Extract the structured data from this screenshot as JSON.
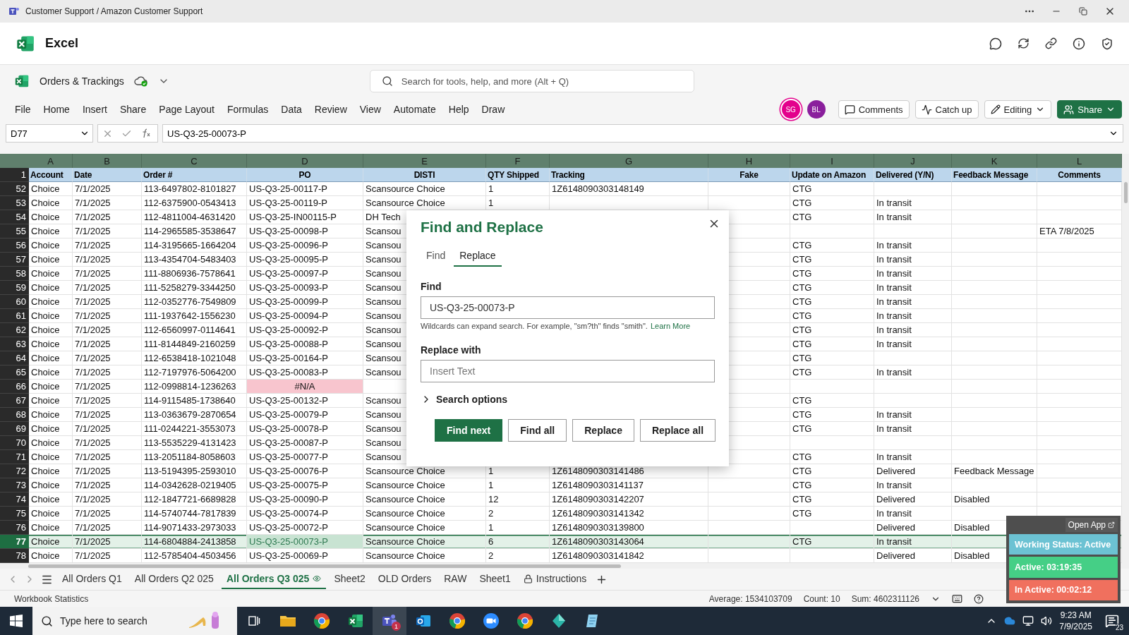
{
  "window": {
    "title": "Customer Support / Amazon Customer Support"
  },
  "app": {
    "name": "Excel"
  },
  "document": {
    "name": "Orders & Trackings"
  },
  "search": {
    "placeholder": "Search for tools, help, and more (Alt + Q)"
  },
  "menu": [
    "File",
    "Home",
    "Insert",
    "Share",
    "Page Layout",
    "Formulas",
    "Data",
    "Review",
    "View",
    "Automate",
    "Help",
    "Draw"
  ],
  "avatars": [
    {
      "initials": "SG",
      "color": "#e3008c",
      "selected": true
    },
    {
      "initials": "BL",
      "color": "#8a1f9c",
      "selected": false
    }
  ],
  "toolbar_buttons": [
    {
      "label": "Comments",
      "kind": "comments"
    },
    {
      "label": "Catch up",
      "kind": "catchup"
    },
    {
      "label": "Editing",
      "kind": "editing"
    },
    {
      "label": "Share",
      "kind": "share"
    }
  ],
  "formula_bar": {
    "cell_ref": "D77",
    "value": "US-Q3-25-00073-P"
  },
  "sheet": {
    "columns": [
      "A",
      "B",
      "C",
      "D",
      "E",
      "F",
      "G",
      "H",
      "I",
      "J",
      "K",
      "L"
    ],
    "header": {
      "number": "1",
      "cells": [
        "Account",
        "Date",
        "Order #",
        "PO",
        "DISTI",
        "QTY Shipped",
        "Tracking",
        "Fake",
        "Update on Amazon",
        "Delivered (Y/N)",
        "Feedback Message",
        "Comments"
      ]
    },
    "rows": [
      {
        "number": "52",
        "selected": false,
        "cells": [
          "Choice",
          "7/1/2025",
          "113-6497802-8101827",
          "US-Q3-25-00117-P",
          "Scansource Choice",
          "1",
          "1Z6148090303148149",
          null,
          "CTG",
          null,
          null,
          null
        ]
      },
      {
        "number": "53",
        "selected": false,
        "cells": [
          "Choice",
          "7/1/2025",
          "112-6375900-0543413",
          "US-Q3-25-00119-P",
          "Scansource Choice",
          "1",
          null,
          null,
          "CTG",
          "In transit",
          null,
          null
        ]
      },
      {
        "number": "54",
        "selected": false,
        "cells": [
          "Choice",
          "7/1/2025",
          "112-4811004-4631420",
          "US-Q3-25-IN00115-P",
          "DH Tech",
          null,
          null,
          null,
          "CTG",
          "In transit",
          null,
          null
        ]
      },
      {
        "number": "55",
        "selected": false,
        "cells": [
          "Choice",
          "7/1/2025",
          "114-2965585-3538647",
          "US-Q3-25-00098-P",
          "Scansou",
          null,
          null,
          null,
          null,
          null,
          null,
          "ETA 7/8/2025"
        ]
      },
      {
        "number": "56",
        "selected": false,
        "cells": [
          "Choice",
          "7/1/2025",
          "114-3195665-1664204",
          "US-Q3-25-00096-P",
          "Scansou",
          null,
          null,
          null,
          "CTG",
          "In transit",
          null,
          null
        ]
      },
      {
        "number": "57",
        "selected": false,
        "cells": [
          "Choice",
          "7/1/2025",
          "113-4354704-5483403",
          "US-Q3-25-00095-P",
          "Scansou",
          null,
          null,
          null,
          "CTG",
          "In transit",
          null,
          null
        ]
      },
      {
        "number": "58",
        "selected": false,
        "cells": [
          "Choice",
          "7/1/2025",
          "111-8806936-7578641",
          "US-Q3-25-00097-P",
          "Scansou",
          null,
          null,
          null,
          "CTG",
          "In transit",
          null,
          null
        ]
      },
      {
        "number": "59",
        "selected": false,
        "cells": [
          "Choice",
          "7/1/2025",
          "111-5258279-3344250",
          "US-Q3-25-00093-P",
          "Scansou",
          null,
          null,
          null,
          "CTG",
          "In transit",
          null,
          null
        ]
      },
      {
        "number": "60",
        "selected": false,
        "cells": [
          "Choice",
          "7/1/2025",
          "112-0352776-7549809",
          "US-Q3-25-00099-P",
          "Scansou",
          null,
          null,
          null,
          "CTG",
          "In transit",
          null,
          null
        ]
      },
      {
        "number": "61",
        "selected": false,
        "cells": [
          "Choice",
          "7/1/2025",
          "111-1937642-1556230",
          "US-Q3-25-00094-P",
          "Scansou",
          null,
          null,
          null,
          "CTG",
          "In transit",
          null,
          null
        ]
      },
      {
        "number": "62",
        "selected": false,
        "cells": [
          "Choice",
          "7/1/2025",
          "112-6560997-0114641",
          "US-Q3-25-00092-P",
          "Scansou",
          null,
          null,
          null,
          "CTG",
          "In transit",
          null,
          null
        ]
      },
      {
        "number": "63",
        "selected": false,
        "cells": [
          "Choice",
          "7/1/2025",
          "111-8144849-2160259",
          "US-Q3-25-00088-P",
          "Scansou",
          null,
          null,
          null,
          "CTG",
          "In transit",
          null,
          null
        ]
      },
      {
        "number": "64",
        "selected": false,
        "cells": [
          "Choice",
          "7/1/2025",
          "112-6538418-1021048",
          "US-Q3-25-00164-P",
          "Scansou",
          null,
          null,
          null,
          "CTG",
          null,
          null,
          null
        ]
      },
      {
        "number": "65",
        "selected": false,
        "cells": [
          "Choice",
          "7/1/2025",
          "112-7197976-5064200",
          "US-Q3-25-00083-P",
          "Scansou",
          null,
          null,
          null,
          "CTG",
          "In transit",
          null,
          null
        ]
      },
      {
        "number": "66",
        "selected": false,
        "cells": [
          "Choice",
          "7/1/2025",
          "112-0998814-1236263",
          {
            "text": "#N/A",
            "kind": "error"
          },
          null,
          null,
          null,
          null,
          null,
          null,
          null,
          null
        ]
      },
      {
        "number": "67",
        "selected": false,
        "cells": [
          "Choice",
          "7/1/2025",
          "114-9115485-1738640",
          "US-Q3-25-00132-P",
          "Scansou",
          null,
          null,
          null,
          "CTG",
          null,
          null,
          null
        ]
      },
      {
        "number": "68",
        "selected": false,
        "cells": [
          "Choice",
          "7/1/2025",
          "113-0363679-2870654",
          "US-Q3-25-00079-P",
          "Scansou",
          null,
          null,
          null,
          "CTG",
          "In transit",
          null,
          null
        ]
      },
      {
        "number": "69",
        "selected": false,
        "cells": [
          "Choice",
          "7/1/2025",
          "111-0244221-3553073",
          "US-Q3-25-00078-P",
          "Scansou",
          null,
          null,
          null,
          "CTG",
          "In transit",
          null,
          null
        ]
      },
      {
        "number": "70",
        "selected": false,
        "cells": [
          "Choice",
          "7/1/2025",
          "113-5535229-4131423",
          "US-Q3-25-00087-P",
          "Scansou",
          null,
          null,
          null,
          null,
          null,
          null,
          null
        ]
      },
      {
        "number": "71",
        "selected": false,
        "cells": [
          "Choice",
          "7/1/2025",
          "113-2051184-8058603",
          "US-Q3-25-00077-P",
          "Scansou",
          null,
          null,
          null,
          "CTG",
          "In transit",
          null,
          null
        ]
      },
      {
        "number": "72",
        "selected": false,
        "cells": [
          "Choice",
          "7/1/2025",
          "113-5194395-2593010",
          "US-Q3-25-00076-P",
          "Scansource Choice",
          "1",
          "1Z6148090303141486",
          null,
          "CTG",
          "Delivered",
          "Feedback Message",
          null
        ]
      },
      {
        "number": "73",
        "selected": false,
        "cells": [
          "Choice",
          "7/1/2025",
          "114-0342628-0219405",
          "US-Q3-25-00075-P",
          "Scansource Choice",
          "1",
          "1Z6148090303141137",
          null,
          "CTG",
          "In transit",
          null,
          null
        ]
      },
      {
        "number": "74",
        "selected": false,
        "cells": [
          "Choice",
          "7/1/2025",
          "112-1847721-6689828",
          "US-Q3-25-00090-P",
          "Scansource Choice",
          "12",
          "1Z6148090303142207",
          null,
          "CTG",
          "Delivered",
          "Disabled",
          null
        ]
      },
      {
        "number": "75",
        "selected": false,
        "cells": [
          "Choice",
          "7/1/2025",
          "114-5740744-7817839",
          "US-Q3-25-00074-P",
          "Scansource Choice",
          "2",
          "1Z6148090303141342",
          null,
          "CTG",
          "In transit",
          null,
          null
        ]
      },
      {
        "number": "76",
        "selected": false,
        "cells": [
          "Choice",
          "7/1/2025",
          "114-9071433-2973033",
          "US-Q3-25-00072-P",
          "Scansource Choice",
          "1",
          "1Z6148090303139800",
          null,
          null,
          "Delivered",
          "Disabled",
          null
        ]
      },
      {
        "number": "77",
        "selected": true,
        "cells": [
          "Choice",
          "7/1/2025",
          "114-6804884-2413858",
          {
            "text": "US-Q3-25-00073-P",
            "kind": "active"
          },
          "Scansource Choice",
          "6",
          "1Z6148090303143064",
          null,
          "CTG",
          "In transit",
          null,
          null
        ]
      },
      {
        "number": "78",
        "selected": false,
        "cells": [
          "Choice",
          "7/1/2025",
          "112-5785404-4503456",
          "US-Q3-25-00069-P",
          "Scansource Choice",
          "2",
          "1Z6148090303141842",
          null,
          null,
          "Delivered",
          "Disabled",
          null
        ]
      }
    ]
  },
  "dialog": {
    "title": "Find and Replace",
    "tabs": [
      {
        "label": "Find",
        "selected": false
      },
      {
        "label": "Replace",
        "selected": true
      }
    ],
    "find_label": "Find",
    "find_value": "US-Q3-25-00073-P",
    "hint": "Wildcards can expand search. For example, \"sm?th\" finds \"smith\".",
    "hint_link": "Learn More",
    "replace_label": "Replace with",
    "replace_placeholder": "Insert Text",
    "search_options": {
      "label": "Search options",
      "expanded": false
    },
    "buttons": [
      {
        "label": "Find next",
        "kind": "primary"
      },
      {
        "label": "Find all",
        "kind": "secondary"
      },
      {
        "label": "Replace",
        "kind": "secondary"
      },
      {
        "label": "Replace all",
        "kind": "secondary"
      }
    ]
  },
  "sheet_tabs": [
    {
      "label": "All Orders Q1",
      "selected": false,
      "kind": "plain"
    },
    {
      "label": "All Orders Q2 025",
      "selected": false,
      "kind": "plain"
    },
    {
      "label": "All Orders Q3 025",
      "selected": true,
      "kind": "watched"
    },
    {
      "label": "Sheet2",
      "selected": false,
      "kind": "plain"
    },
    {
      "label": "OLD Orders",
      "selected": false,
      "kind": "plain"
    },
    {
      "label": "RAW",
      "selected": false,
      "kind": "plain"
    },
    {
      "label": "Sheet1",
      "selected": false,
      "kind": "plain"
    },
    {
      "label": "Instructions",
      "selected": false,
      "kind": "locked"
    }
  ],
  "status_bar": {
    "left": "Workbook Statistics",
    "stats": [
      "Average: 1534103709",
      "Count: 10",
      "Sum: 4602311126"
    ]
  },
  "tracker": {
    "open_app": "Open App",
    "rows": [
      {
        "label": "Working Status: Active",
        "color": "#6cc2d3"
      },
      {
        "label": "Active: 03:19:35",
        "color": "#45cf86"
      },
      {
        "label": "In Active: 00:02:12",
        "color": "#f0705e"
      }
    ]
  },
  "taskbar": {
    "search_placeholder": "Type here to search",
    "apps": [
      {
        "kind": "taskview",
        "selected": false
      },
      {
        "kind": "folder",
        "selected": false
      },
      {
        "kind": "chrome",
        "selected": false
      },
      {
        "kind": "excel",
        "selected": false
      },
      {
        "kind": "teams",
        "selected": true,
        "badge": "1"
      },
      {
        "kind": "outlook",
        "selected": false
      },
      {
        "kind": "chrome",
        "selected": false
      },
      {
        "kind": "zoom",
        "selected": false
      },
      {
        "kind": "chrome",
        "selected": false
      },
      {
        "kind": "diamond",
        "selected": false
      },
      {
        "kind": "notes",
        "selected": false
      }
    ],
    "time": "9:23 AM",
    "date": "7/9/2025",
    "notifications": "23"
  }
}
